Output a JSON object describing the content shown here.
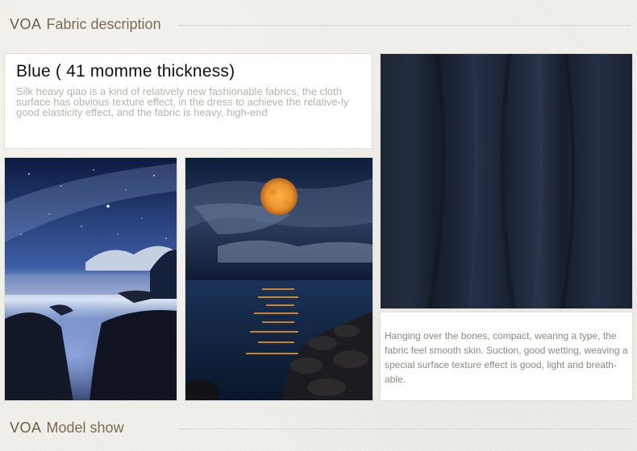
{
  "header_top": {
    "brand": "VOA",
    "title": "Fabric description"
  },
  "description": {
    "title": "Blue ( 41 momme thickness)",
    "body": "Silk heavy qiao is a kind of relatively new fashionable fabrics, the cloth surface has obvious texture effect, in the dress to achieve the relative-ly good elasticity effect, and the fabric is heavy, high-end"
  },
  "caption": {
    "text": "Hanging over the bones, compact, wearing a type, the fabric feel smooth skin. Suction, good wetting, weaving a special surface texture effect is good, light and breath-able."
  },
  "header_bottom": {
    "brand": "VOA",
    "title": "Model show"
  },
  "colors": {
    "fabric_navy": "#1b2434",
    "moon_orange": "#e7932a",
    "sea_blue": "#13294b"
  }
}
